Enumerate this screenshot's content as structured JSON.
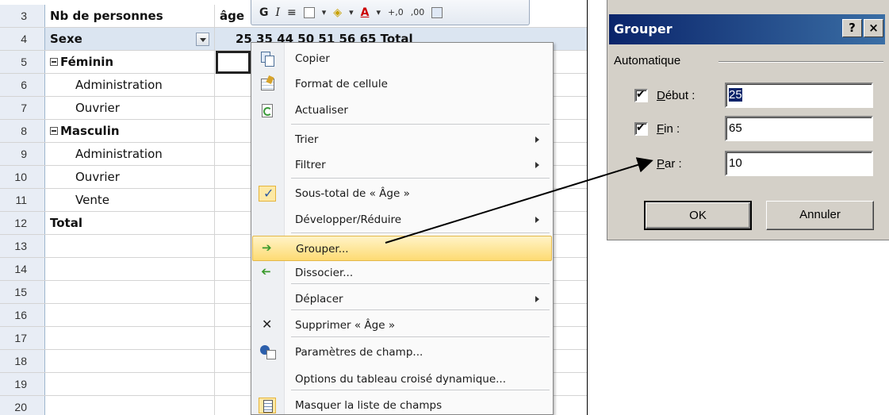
{
  "sheet": {
    "rows": [
      {
        "num": "3",
        "a": "Nb de personnes",
        "b": "âge",
        "style": "bold"
      },
      {
        "num": "4",
        "a": "Sexe",
        "b": "25 35  44  50  51  56  65  Total",
        "style": "header"
      },
      {
        "num": "5",
        "a": "Féminin",
        "b": "",
        "style": "group"
      },
      {
        "num": "6",
        "a": "Administration",
        "b": "",
        "style": "item"
      },
      {
        "num": "7",
        "a": "Ouvrier",
        "b": "",
        "style": "item"
      },
      {
        "num": "8",
        "a": "Masculin",
        "b": "",
        "style": "group"
      },
      {
        "num": "9",
        "a": "Administration",
        "b": "",
        "style": "item"
      },
      {
        "num": "10",
        "a": "Ouvrier",
        "b": "",
        "style": "item"
      },
      {
        "num": "11",
        "a": "Vente",
        "b": "",
        "style": "item"
      },
      {
        "num": "12",
        "a": "Total",
        "b": "",
        "style": "total"
      },
      {
        "num": "13",
        "a": "",
        "b": "",
        "style": ""
      },
      {
        "num": "14",
        "a": "",
        "b": "",
        "style": ""
      },
      {
        "num": "15",
        "a": "",
        "b": "",
        "style": ""
      },
      {
        "num": "16",
        "a": "",
        "b": "",
        "style": ""
      },
      {
        "num": "17",
        "a": "",
        "b": "",
        "style": ""
      },
      {
        "num": "18",
        "a": "",
        "b": "",
        "style": ""
      },
      {
        "num": "19",
        "a": "",
        "b": "",
        "style": ""
      },
      {
        "num": "20",
        "a": "",
        "b": "",
        "style": ""
      }
    ]
  },
  "mini_toolbar": {
    "bold": "G",
    "italic": "I",
    "align": "≡",
    "increase_decimal": "+,0",
    "decrease_decimal": ",00",
    "font_color": "A"
  },
  "context_menu": {
    "items": [
      {
        "label": "Copier",
        "icon": "copy-icon",
        "submenu": false
      },
      {
        "label": "Format de cellule",
        "icon": "format-cells-icon",
        "submenu": false
      },
      {
        "label": "Actualiser",
        "icon": "refresh-icon",
        "submenu": false
      },
      {
        "label": "Trier",
        "icon": "",
        "submenu": true
      },
      {
        "label": "Filtrer",
        "icon": "",
        "submenu": true
      },
      {
        "label": "Sous-total de « Âge »",
        "icon": "checkmark-icon",
        "submenu": false
      },
      {
        "label": "Développer/Réduire",
        "icon": "",
        "submenu": true
      },
      {
        "label": "Grouper...",
        "icon": "group-arrow-icon",
        "submenu": false,
        "highlighted": true
      },
      {
        "label": "Dissocier...",
        "icon": "ungroup-arrow-icon",
        "submenu": false
      },
      {
        "label": "Déplacer",
        "icon": "",
        "submenu": true
      },
      {
        "label": "Supprimer « Âge »",
        "icon": "delete-icon",
        "submenu": false
      },
      {
        "label": "Paramètres de champ...",
        "icon": "field-settings-icon",
        "submenu": false
      },
      {
        "label": "Options du tableau croisé dynamique...",
        "icon": "",
        "submenu": false
      },
      {
        "label": "Masquer la liste de champs",
        "icon": "field-list-icon",
        "submenu": false
      }
    ]
  },
  "dialog": {
    "title": "Grouper",
    "help_button": "?",
    "close_button": "×",
    "group_label": "Automatique",
    "debut_label": "Début :",
    "fin_label": "Fin :",
    "par_label": "Par :",
    "debut_value": "25",
    "fin_value": "65",
    "par_value": "10",
    "ok_label": "OK",
    "cancel_label": "Annuler"
  },
  "colors": {
    "title_bar": "#0a246a",
    "menu_highlight": "#fedb73",
    "dialog_face": "#d4d0c8",
    "header_row": "#dbe5f1"
  }
}
